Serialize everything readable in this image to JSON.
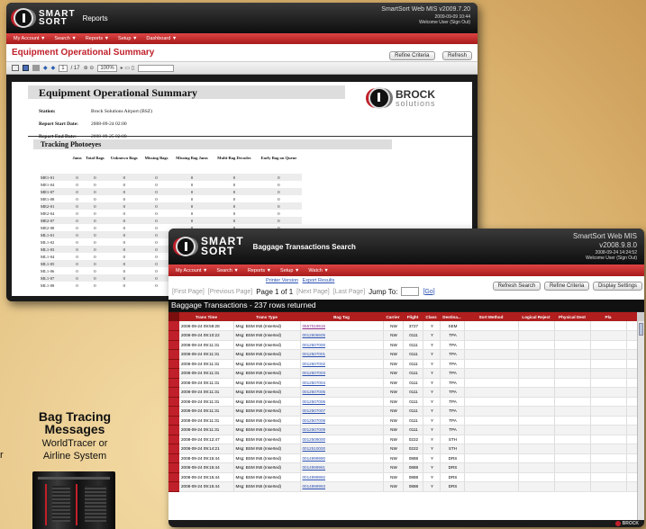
{
  "brand": {
    "word1": "SMART",
    "word2": "SORT"
  },
  "win1": {
    "app_title": "Reports",
    "version_lines": [
      "SmartSort Web MIS v2009.7.20",
      "2009-09-09 10:44",
      "Welcome User (Sign Out)"
    ],
    "menu": [
      "My Account ▼",
      "Search ▼",
      "Reports ▼",
      "Setup ▼",
      "Dashboard ▼"
    ],
    "page_title": "Equipment Operational Summary",
    "buttons": {
      "refine": "Refine Criteria",
      "refresh": "Refresh"
    },
    "viewer_toolbar": {
      "page": "1",
      "of": "/ 17",
      "zoom": "100%"
    },
    "report": {
      "title": "Equipment Operational Summary",
      "company_logo": {
        "word1": "BROCK",
        "word2": "solutions"
      },
      "meta": [
        {
          "label": "Station:",
          "value": "Brock Solutions Airport (BSZ)"
        },
        {
          "label": "Report Start Date:",
          "value": "2008-09-24 02:00"
        },
        {
          "label": "Report End Date:",
          "value": "2008-09-25 02:00"
        }
      ],
      "section_title": "Tracking Photoeyes",
      "columns": [
        "Jams",
        "Total Bags",
        "Unknown Bags",
        "Missing Bags",
        "Missing Bag Jams",
        "Multi-Bag Decodes",
        "Early Bag on Queue"
      ],
      "rows": [
        {
          "id": "ME1-01",
          "vals": [
            "0",
            "0",
            "0",
            "0",
            "0",
            "0",
            "0"
          ]
        },
        {
          "id": "ME1-04",
          "vals": [
            "0",
            "0",
            "0",
            "0",
            "0",
            "0",
            "0"
          ]
        },
        {
          "id": "ME1-07",
          "vals": [
            "0",
            "0",
            "0",
            "0",
            "0",
            "0",
            "0"
          ]
        },
        {
          "id": "ME1-08",
          "vals": [
            "0",
            "0",
            "0",
            "0",
            "0",
            "0",
            "0"
          ]
        },
        {
          "id": "ME2-01",
          "vals": [
            "0",
            "0",
            "0",
            "0",
            "0",
            "0",
            "0"
          ]
        },
        {
          "id": "ME2-04",
          "vals": [
            "0",
            "0",
            "0",
            "0",
            "0",
            "0",
            "0"
          ]
        },
        {
          "id": "ME2-07",
          "vals": [
            "0",
            "0",
            "0",
            "0",
            "0",
            "0",
            "0"
          ]
        },
        {
          "id": "ME2-08",
          "vals": [
            "0",
            "0",
            "0",
            "0",
            "0",
            "0",
            "0"
          ]
        },
        {
          "id": "ML1-01",
          "vals": [
            "0",
            "0",
            "0",
            "0",
            "0",
            "0",
            "0"
          ]
        },
        {
          "id": "ML1-02",
          "vals": [
            "0",
            "0",
            "0",
            "0",
            "0",
            "0",
            "0"
          ]
        },
        {
          "id": "ML1-03",
          "vals": [
            "0",
            "0",
            "0",
            "0",
            "0",
            "0",
            "0"
          ]
        },
        {
          "id": "ML1-04",
          "vals": [
            "0",
            "0",
            "0",
            "0",
            "0",
            "0",
            "0"
          ]
        },
        {
          "id": "ML1-05",
          "vals": [
            "0",
            "0",
            "0",
            "0",
            "0",
            "0",
            "0"
          ]
        },
        {
          "id": "ML1-06",
          "vals": [
            "0",
            "0",
            "0",
            "0",
            "0",
            "0",
            "0"
          ]
        },
        {
          "id": "ML1-07",
          "vals": [
            "0",
            "0",
            "0",
            "0",
            "0",
            "0",
            "0"
          ]
        },
        {
          "id": "ML1-08",
          "vals": [
            "0",
            "0",
            "0",
            "0",
            "0",
            "0",
            "0"
          ]
        }
      ]
    }
  },
  "win2": {
    "app_title": "Baggage Transactions Search",
    "version_lines": [
      "SmartSort Web MIS",
      "v2008.9.8.0",
      "2008-09-24 14:24:52",
      "Welcome User (Sign Out)"
    ],
    "menu": [
      "My Account ▼",
      "Search ▼",
      "Reports ▼",
      "Setup ▼",
      "Watch ▼"
    ],
    "links": {
      "printer": "Printer Version",
      "export": "Export Results"
    },
    "pager": {
      "first": "[First Page]",
      "prev": "[Previous Page]",
      "page": "Page 1 of 1",
      "next": "[Next Page]",
      "last": "[Last Page]",
      "jump_label": "Jump To:",
      "go": "[Go]"
    },
    "buttons": {
      "refresh_search": "Refresh Search",
      "refine": "Refine Criteria",
      "display": "Display Settings"
    },
    "results_heading": "Baggage Transactions - 237 rows returned",
    "columns": [
      "Trans Time",
      "Trans Type",
      "Bag Tag",
      "Carrier",
      "Flight",
      "Class",
      "Destina...",
      "Sort Method",
      "Logical Reject",
      "Physical Dest",
      "Pla"
    ],
    "rows": [
      {
        "time": "2008-09-24 09:59:28",
        "type": "Msg: BSM IN8 (Inserted)",
        "tag": "0557019515",
        "carrier": "NW",
        "flight": "3727",
        "cls": "Y",
        "dest": "SEM"
      },
      {
        "time": "2008-09-24 09:10:22",
        "type": "Msg: BSM IN8 (Inserted)",
        "tag": "0012506605",
        "carrier": "NW",
        "flight": "0111",
        "cls": "Y",
        "dest": "TPA"
      },
      {
        "time": "2008-09-24 09:11:31",
        "type": "Msg: BSM IN8 (Inserted)",
        "tag": "0012507000",
        "carrier": "NW",
        "flight": "0111",
        "cls": "Y",
        "dest": "TPA"
      },
      {
        "time": "2008-09-24 09:11:31",
        "type": "Msg: BSM IN8 (Inserted)",
        "tag": "0012507001",
        "carrier": "NW",
        "flight": "0111",
        "cls": "Y",
        "dest": "TPA"
      },
      {
        "time": "2008-09-24 09:11:31",
        "type": "Msg: BSM IN8 (Inserted)",
        "tag": "0012507002",
        "carrier": "NW",
        "flight": "0111",
        "cls": "Y",
        "dest": "TPA"
      },
      {
        "time": "2008-09-24 09:11:31",
        "type": "Msg: BSM IN8 (Inserted)",
        "tag": "0012507003",
        "carrier": "NW",
        "flight": "0111",
        "cls": "Y",
        "dest": "TPA"
      },
      {
        "time": "2008-09-24 09:11:31",
        "type": "Msg: BSM IN8 (Inserted)",
        "tag": "0012507004",
        "carrier": "NW",
        "flight": "0111",
        "cls": "Y",
        "dest": "TPA"
      },
      {
        "time": "2008-09-24 09:11:31",
        "type": "Msg: BSM IN8 (Inserted)",
        "tag": "0012507005",
        "carrier": "NW",
        "flight": "0111",
        "cls": "Y",
        "dest": "TPA"
      },
      {
        "time": "2008-09-24 09:11:31",
        "type": "Msg: BSM IN8 (Inserted)",
        "tag": "0012507006",
        "carrier": "NW",
        "flight": "0111",
        "cls": "Y",
        "dest": "TPA"
      },
      {
        "time": "2008-09-24 09:11:31",
        "type": "Msg: BSM IN8 (Inserted)",
        "tag": "0012507007",
        "carrier": "NW",
        "flight": "0111",
        "cls": "Y",
        "dest": "TPA"
      },
      {
        "time": "2008-09-24 09:11:31",
        "type": "Msg: BSM IN8 (Inserted)",
        "tag": "0012507008",
        "carrier": "NW",
        "flight": "0111",
        "cls": "Y",
        "dest": "TPA"
      },
      {
        "time": "2008-09-24 09:11:31",
        "type": "Msg: BSM IN8 (Inserted)",
        "tag": "0012507009",
        "carrier": "NW",
        "flight": "0111",
        "cls": "Y",
        "dest": "TPA"
      },
      {
        "time": "2008-09-24 09:12:47",
        "type": "Msg: BSM IN8 (Inserted)",
        "tag": "0012509000",
        "carrier": "NW",
        "flight": "0222",
        "cls": "Y",
        "dest": "STH"
      },
      {
        "time": "2008-09-24 09:14:21",
        "type": "Msg: BSM IN8 (Inserted)",
        "tag": "0012510000",
        "carrier": "NW",
        "flight": "0222",
        "cls": "Y",
        "dest": "STH"
      },
      {
        "time": "2008-09-24 09:15:44",
        "type": "Msg: BSM IN8 (Inserted)",
        "tag": "0014999990",
        "carrier": "NW",
        "flight": "0888",
        "cls": "Y",
        "dest": "DRS"
      },
      {
        "time": "2008-09-24 09:15:44",
        "type": "Msg: BSM IN8 (Inserted)",
        "tag": "0014999991",
        "carrier": "NW",
        "flight": "0888",
        "cls": "Y",
        "dest": "DRS"
      },
      {
        "time": "2008-09-24 09:15:44",
        "type": "Msg: BSM IN8 (Inserted)",
        "tag": "0014999992",
        "carrier": "NW",
        "flight": "0888",
        "cls": "Y",
        "dest": "DRS"
      },
      {
        "time": "2008-09-24 09:15:44",
        "type": "Msg: BSM IN8 (Inserted)",
        "tag": "0014999993",
        "carrier": "NW",
        "flight": "0888",
        "cls": "Y",
        "dest": "DRS"
      }
    ]
  },
  "diagram": {
    "line1": "Bag Tracing",
    "line2": "Messages",
    "line3": "WorldTracer or",
    "line4": "Airline System",
    "cut_letter": "r"
  },
  "colors": {
    "accent_red": "#c0202a",
    "header_black": "#111111"
  },
  "icons": [
    "printer-icon",
    "save-icon",
    "prev-page-icon",
    "next-page-icon",
    "zoom-icon",
    "mainframe-server-icon"
  ]
}
